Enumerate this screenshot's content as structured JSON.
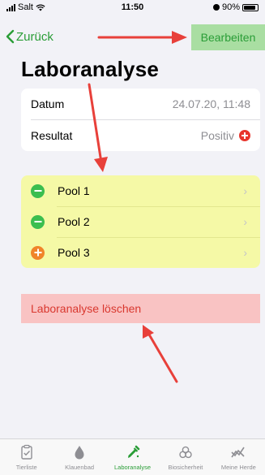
{
  "status_bar": {
    "carrier": "Salt",
    "time": "11:50",
    "battery_percent": "90%",
    "battery_level": 0.9
  },
  "nav": {
    "back_label": "Zurück",
    "edit_label": "Bearbeiten"
  },
  "page_title": "Laboranalyse",
  "info": {
    "date_label": "Datum",
    "date_value": "24.07.20, 11:48",
    "result_label": "Resultat",
    "result_value": "Positiv"
  },
  "pools": [
    {
      "label": "Pool 1",
      "status": "minus",
      "color": "#3bbe4f"
    },
    {
      "label": "Pool 2",
      "status": "minus",
      "color": "#3bbe4f"
    },
    {
      "label": "Pool 3",
      "status": "plus",
      "color": "#f0842a"
    }
  ],
  "delete_label": "Laboranalyse löschen",
  "tabs": [
    {
      "label": "Tierliste",
      "icon": "clipboard-icon",
      "active": false
    },
    {
      "label": "Klauenbad",
      "icon": "drop-icon",
      "active": false
    },
    {
      "label": "Laboranalyse",
      "icon": "pipette-icon",
      "active": true
    },
    {
      "label": "Biosicherheit",
      "icon": "biohazard-icon",
      "active": false
    },
    {
      "label": "Meine Herde",
      "icon": "trend-icon",
      "active": false
    }
  ],
  "colors": {
    "accent": "#2a9d37",
    "highlight_edit": "#a9dea2",
    "highlight_pools": "#f5f9a6",
    "highlight_delete": "#f9c3c3",
    "annotation_arrow": "#e8403a"
  }
}
